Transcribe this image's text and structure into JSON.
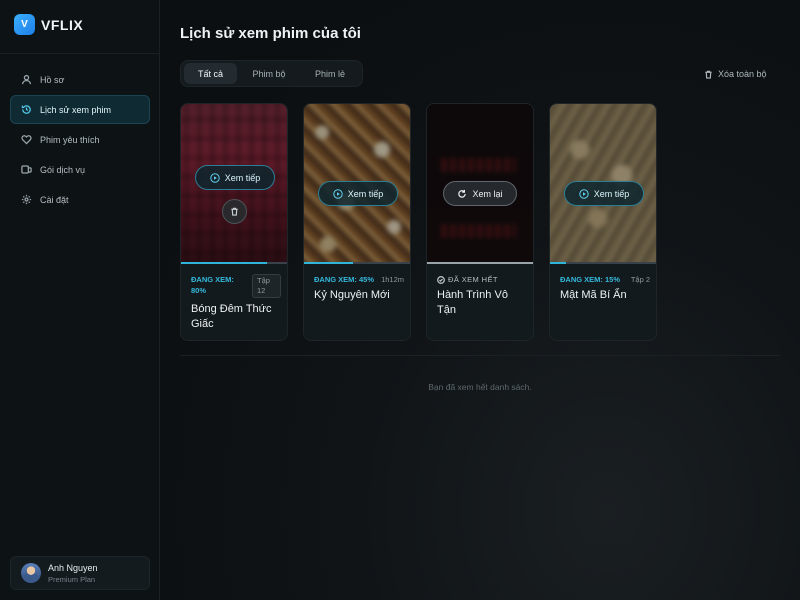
{
  "brand": {
    "logo_letter": "V",
    "name": "VFLIX",
    "accent": "#2f9cf2"
  },
  "sidebar": {
    "items": [
      {
        "label": "Hồ sơ",
        "icon": "user-icon",
        "active": false
      },
      {
        "label": "Lịch sử xem phim",
        "icon": "history-icon",
        "active": true
      },
      {
        "label": "Phim yêu thích",
        "icon": "heart-icon",
        "active": false
      },
      {
        "label": "Gói dịch vụ",
        "icon": "plans-icon",
        "active": false
      },
      {
        "label": "Cài đặt",
        "icon": "gear-icon",
        "active": false
      }
    ],
    "user": {
      "name": "Anh Nguyen",
      "plan": "Premium Plan"
    }
  },
  "main": {
    "title": "Lịch sử xem phim của tôi",
    "filters": [
      "Tất cả",
      "Phim bộ",
      "Phim lẻ"
    ],
    "active_filter": "Tất cả",
    "clear_all_label": "Xóa toàn bộ",
    "end_note": "Bạn đã xem hết danh sách."
  },
  "cards": [
    {
      "title": "Bóng Đêm Thức Giấc",
      "status": "ĐANG XEM: 80%",
      "meta": "Tập 12",
      "progress": 0.8,
      "action": "Xem tiếp",
      "art": "red-collage"
    },
    {
      "title": "Kỷ Nguyên Mới",
      "status": "ĐANG XEM: 45%",
      "meta": "1h12m",
      "progress": 0.45,
      "action": "Xem tiếp",
      "art": "gold-collage"
    },
    {
      "title": "Hành Trình Vô Tận",
      "status": "ĐÃ XEM HẾT",
      "meta": "",
      "progress": 1.0,
      "action": "Xem lại",
      "art": "dark-red"
    },
    {
      "title": "Mật Mã Bí Ẩn",
      "status": "ĐANG XEM: 15%",
      "meta": "Tập 2",
      "progress": 0.15,
      "action": "Xem tiếp",
      "art": "sand-collage"
    }
  ],
  "colors": {
    "accent": "#2fb4da",
    "background": "#0b1013",
    "card": "#131a1d"
  }
}
